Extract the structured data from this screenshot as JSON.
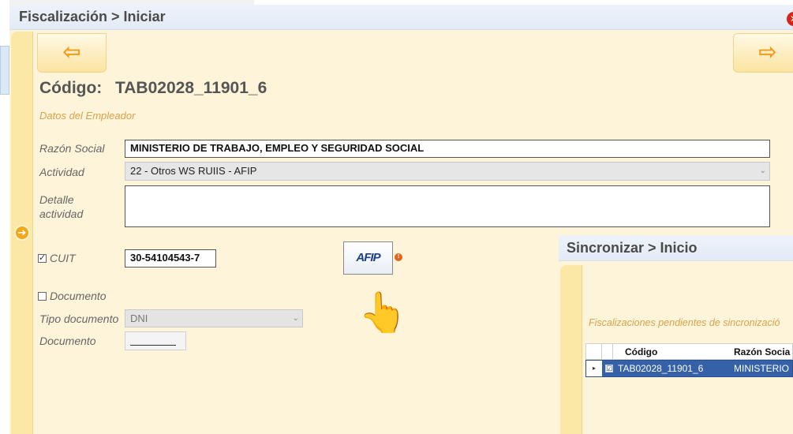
{
  "main_window": {
    "title": "Fiscalización > Iniciar",
    "close_glyph": "✕",
    "nav_back_glyph": "⇦",
    "nav_forward_glyph": "⇨",
    "side_arrow_glyph": "➔",
    "code_label": "Código:",
    "code_value": "TAB02028_11901_6",
    "section_title": "Datos del Empleador",
    "razon_social": {
      "label": "Razón Social",
      "value": "MINISTERIO DE TRABAJO, EMPLEO Y SEGURIDAD SOCIAL"
    },
    "actividad": {
      "label": "Actividad",
      "value": "22 - Otros WS RUIIS - AFIP"
    },
    "detalle_actividad": {
      "label_line1": "Detalle",
      "label_line2": "actividad",
      "value": ""
    },
    "cuit": {
      "label": "CUIT",
      "checked": true,
      "value": "30-54104543-7"
    },
    "afip_button": {
      "label": "AFIP",
      "icon": "afip-logo-icon"
    },
    "warning_glyph": "!",
    "hand_glyph": "👆",
    "documento_checkbox": {
      "label": "Documento",
      "checked": false
    },
    "tipo_documento": {
      "label": "Tipo documento",
      "value": "DNI"
    },
    "documento": {
      "label": "Documento",
      "value": ""
    }
  },
  "sync_window": {
    "title": "Sincronizar > Inicio",
    "caption": "Fiscalizaciones pendientes de sincronizació",
    "grid": {
      "columns": [
        "Código",
        "Razón Socia"
      ],
      "rows": [
        {
          "indicator": "▸",
          "checked": "☑",
          "codigo": "TAB02028_11901_6",
          "razon_social": "MINISTERIO"
        }
      ]
    }
  },
  "colors": {
    "panel_bg": "#fdf4d9",
    "strip_bg": "#fbe7a6",
    "accent_orange": "#f29a1b",
    "section_text": "#d9a24a",
    "selected_row": "#3561a8",
    "close_red": "#d9261c"
  }
}
